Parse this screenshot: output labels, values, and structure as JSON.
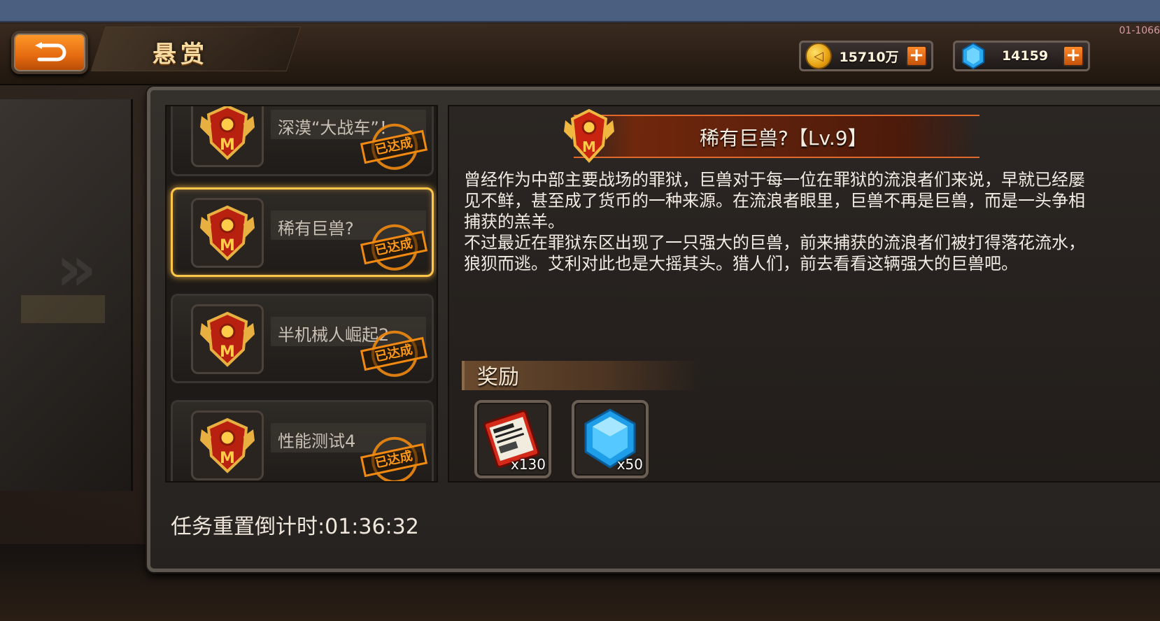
{
  "header": {
    "title": "悬赏",
    "build_id": "01-1066"
  },
  "currency": {
    "gold": {
      "amount": "15710万",
      "icon": "gold-coin-icon"
    },
    "gems": {
      "amount": "14159",
      "icon": "blue-gem-icon"
    }
  },
  "bounty_list": {
    "items": [
      {
        "name": "深漠“大战车”！",
        "status": "已达成",
        "selected": false
      },
      {
        "name": "稀有巨兽?",
        "status": "已达成",
        "selected": true
      },
      {
        "name": "半机械人崛起2",
        "status": "已达成",
        "selected": false
      },
      {
        "name": "性能测试4",
        "status": "已达成",
        "selected": false
      }
    ]
  },
  "detail": {
    "title": "稀有巨兽?【Lv.9】",
    "description": [
      "曾经作为中部主要战场的罪狱，巨兽对于每一位在罪狱的流浪者们来说，早就已经屡见不鲜，甚至成了货币的一种来源。在流浪者眼里，巨兽不再是巨兽，而是一头争相捕获的羔羊。",
      "不过最近在罪狱东区出现了一只强大的巨兽，前来捕获的流浪者们被打得落花流水，狼狈而逃。艾利对此也是大摇其头。猎人们，前去看看这辆强大的巨兽吧。"
    ],
    "reward_label": "奖励",
    "rewards": [
      {
        "item": "ticket-item-icon",
        "quantity": "x130"
      },
      {
        "item": "blue-gem-item-icon",
        "quantity": "x50"
      }
    ]
  },
  "footer": {
    "countdown": "任务重置倒计时:01:36:32"
  },
  "colors": {
    "accent_orange": "#f08a12",
    "selected_border": "#ffc64a",
    "title_gold": "#f6dca0"
  }
}
